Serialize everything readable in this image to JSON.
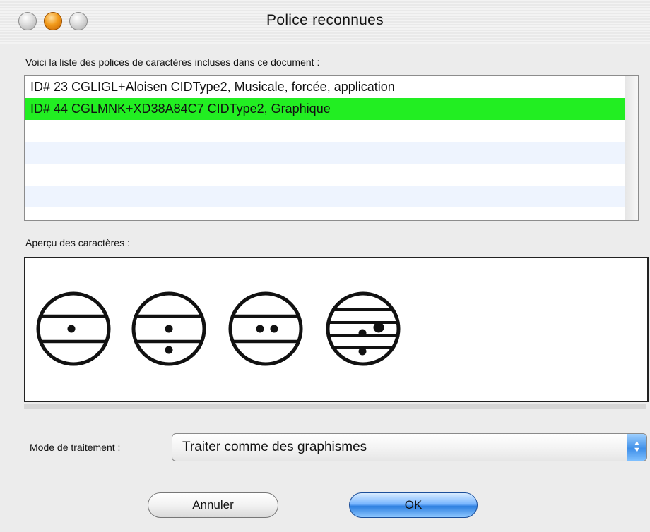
{
  "window": {
    "title": "Police reconnues"
  },
  "fonts_list": {
    "label": "Voici la liste des polices de caractères incluses dans ce document :",
    "rows": [
      {
        "text": "ID# 23 CGLIGL+Aloisen CIDType2, Musicale, forcée, application",
        "selected": false
      },
      {
        "text": "ID# 44 CGLMNK+XD38A84C7 CIDType2, Graphique",
        "selected": true
      }
    ],
    "selection_color": "#22ee22",
    "stripe_color": "#eef4fe"
  },
  "preview": {
    "label": "Aperçu des caractères :",
    "glyphs": [
      "circle-two-lines-one-dot",
      "circle-two-lines-two-dots-vertical",
      "circle-two-lines-two-dots-horizontal",
      "circle-four-lines-three-dots"
    ]
  },
  "mode": {
    "label": "Mode de traitement :",
    "selected": "Traiter comme des graphismes"
  },
  "buttons": {
    "cancel": "Annuler",
    "ok": "OK"
  }
}
